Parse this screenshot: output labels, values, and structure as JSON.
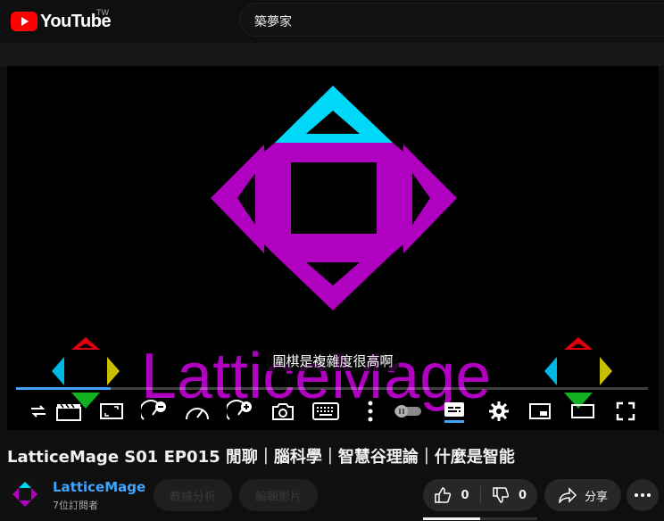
{
  "header": {
    "logo_text": "YouTube",
    "region": "TW",
    "search_value": "築夢家"
  },
  "player": {
    "watermark_text": "LatticeMage",
    "subtitle": "圍棋是複雜度很高啊",
    "progress": 0.15,
    "controls": [
      {
        "name": "loop-icon"
      },
      {
        "name": "clapperboard-icon"
      },
      {
        "name": "aspect-ratio-icon"
      },
      {
        "name": "volume-minus-icon"
      },
      {
        "name": "speedometer-icon"
      },
      {
        "name": "volume-plus-icon"
      },
      {
        "name": "screenshot-camera-icon"
      },
      {
        "name": "keyboard-icon"
      },
      {
        "name": "more-vertical-icon"
      },
      {
        "name": "autoplay-toggle"
      },
      {
        "name": "subtitles-icon"
      },
      {
        "name": "settings-gear-icon"
      },
      {
        "name": "miniplayer-icon"
      },
      {
        "name": "theater-mode-icon"
      },
      {
        "name": "fullscreen-icon"
      }
    ]
  },
  "video": {
    "title": "LatticeMage S01 EP015 閒聊｜腦科學｜智慧谷理論｜什麼是智能",
    "channel_name": "LatticeMage",
    "subscribers": "7位訂閱者",
    "analytics_label": "數據分析",
    "edit_label": "編輯影片",
    "like_count": "0",
    "dislike_count": "0",
    "share_label": "分享"
  },
  "colors": {
    "accent": "#3ea6ff",
    "brand_red": "#ff0000",
    "logo_magenta": "#b000c0",
    "logo_cyan": "#00d8f8"
  }
}
